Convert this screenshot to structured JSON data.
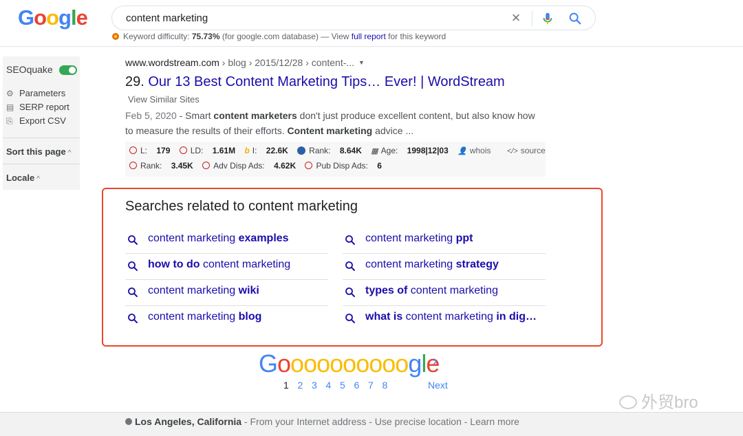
{
  "header": {
    "logo": {
      "text": "Google",
      "colors": [
        "#4285f4",
        "#ea4335",
        "#fbbc05",
        "#4285f4",
        "#34a853",
        "#ea4335"
      ]
    },
    "search": {
      "value": "content marketing"
    },
    "keyword_difficulty": {
      "prefix": "Keyword difficulty: ",
      "value": "75.73%",
      "suffix": " (for google.com database) — View ",
      "link": "full report",
      "tail": " for this keyword"
    }
  },
  "sidebar": {
    "title": "SEOquake",
    "items": [
      {
        "label": "Parameters",
        "icon": "gear-icon"
      },
      {
        "label": "SERP report",
        "icon": "table-icon"
      },
      {
        "label": "Export CSV",
        "icon": "export-icon"
      }
    ],
    "sort_label": "Sort this page",
    "locale_label": "Locale"
  },
  "result": {
    "cite_domain": "www.wordstream.com",
    "cite_path": " › blog › 2015/12/28 › content-...",
    "number": "29. ",
    "title": "Our 13 Best Content Marketing Tips… Ever! | WordStream",
    "similar": "View Similar Sites",
    "snippet": {
      "date": "Feb 5, 2020",
      "p1": " - Smart ",
      "b1": "content marketers",
      "p2": " don't just produce excellent content, but also know how to measure the results of their efforts. ",
      "b2": "Content marketing",
      "p3": " advice ..."
    },
    "metrics_row1": [
      {
        "label": "L: ",
        "value": "179"
      },
      {
        "label": "LD: ",
        "value": "1.61M"
      },
      {
        "label": "I: ",
        "value": "22.6K"
      },
      {
        "label": "Rank: ",
        "value": "8.64K"
      },
      {
        "label": "Age: ",
        "value": "1998|12|03"
      },
      {
        "label": "whois",
        "value": ""
      },
      {
        "label": "source",
        "value": ""
      }
    ],
    "metrics_row2": [
      {
        "label": "Rank: ",
        "value": "3.45K"
      },
      {
        "label": "Adv Disp Ads: ",
        "value": "4.62K"
      },
      {
        "label": "Pub Disp Ads: ",
        "value": "6"
      }
    ]
  },
  "related": {
    "title": "Searches related to content marketing",
    "items": [
      {
        "pre": "content marketing ",
        "bold": "examples",
        "post": ""
      },
      {
        "pre": "content marketing ",
        "bold": "ppt",
        "post": ""
      },
      {
        "pre": "",
        "bold": "how to do",
        "post": " content marketing"
      },
      {
        "pre": "content marketing ",
        "bold": "strategy",
        "post": ""
      },
      {
        "pre": "content marketing ",
        "bold": "wiki",
        "post": ""
      },
      {
        "pre": "",
        "bold": "types of",
        "post": " content marketing"
      },
      {
        "pre": "content marketing ",
        "bold": "blog",
        "post": ""
      },
      {
        "pre": "",
        "bold": "what is",
        "post": " content marketing ",
        "bold2": "in dig…"
      }
    ]
  },
  "pagination": {
    "logo_text": "Goooooooooogle",
    "pages": [
      "1",
      "2",
      "3",
      "4",
      "5",
      "6",
      "7",
      "8"
    ],
    "current": "1",
    "next_label": "Next"
  },
  "footer": {
    "location": "Los Angeles, California",
    "rest": " - From your Internet address - Use precise location - Learn more"
  },
  "watermark": "外贸bro"
}
